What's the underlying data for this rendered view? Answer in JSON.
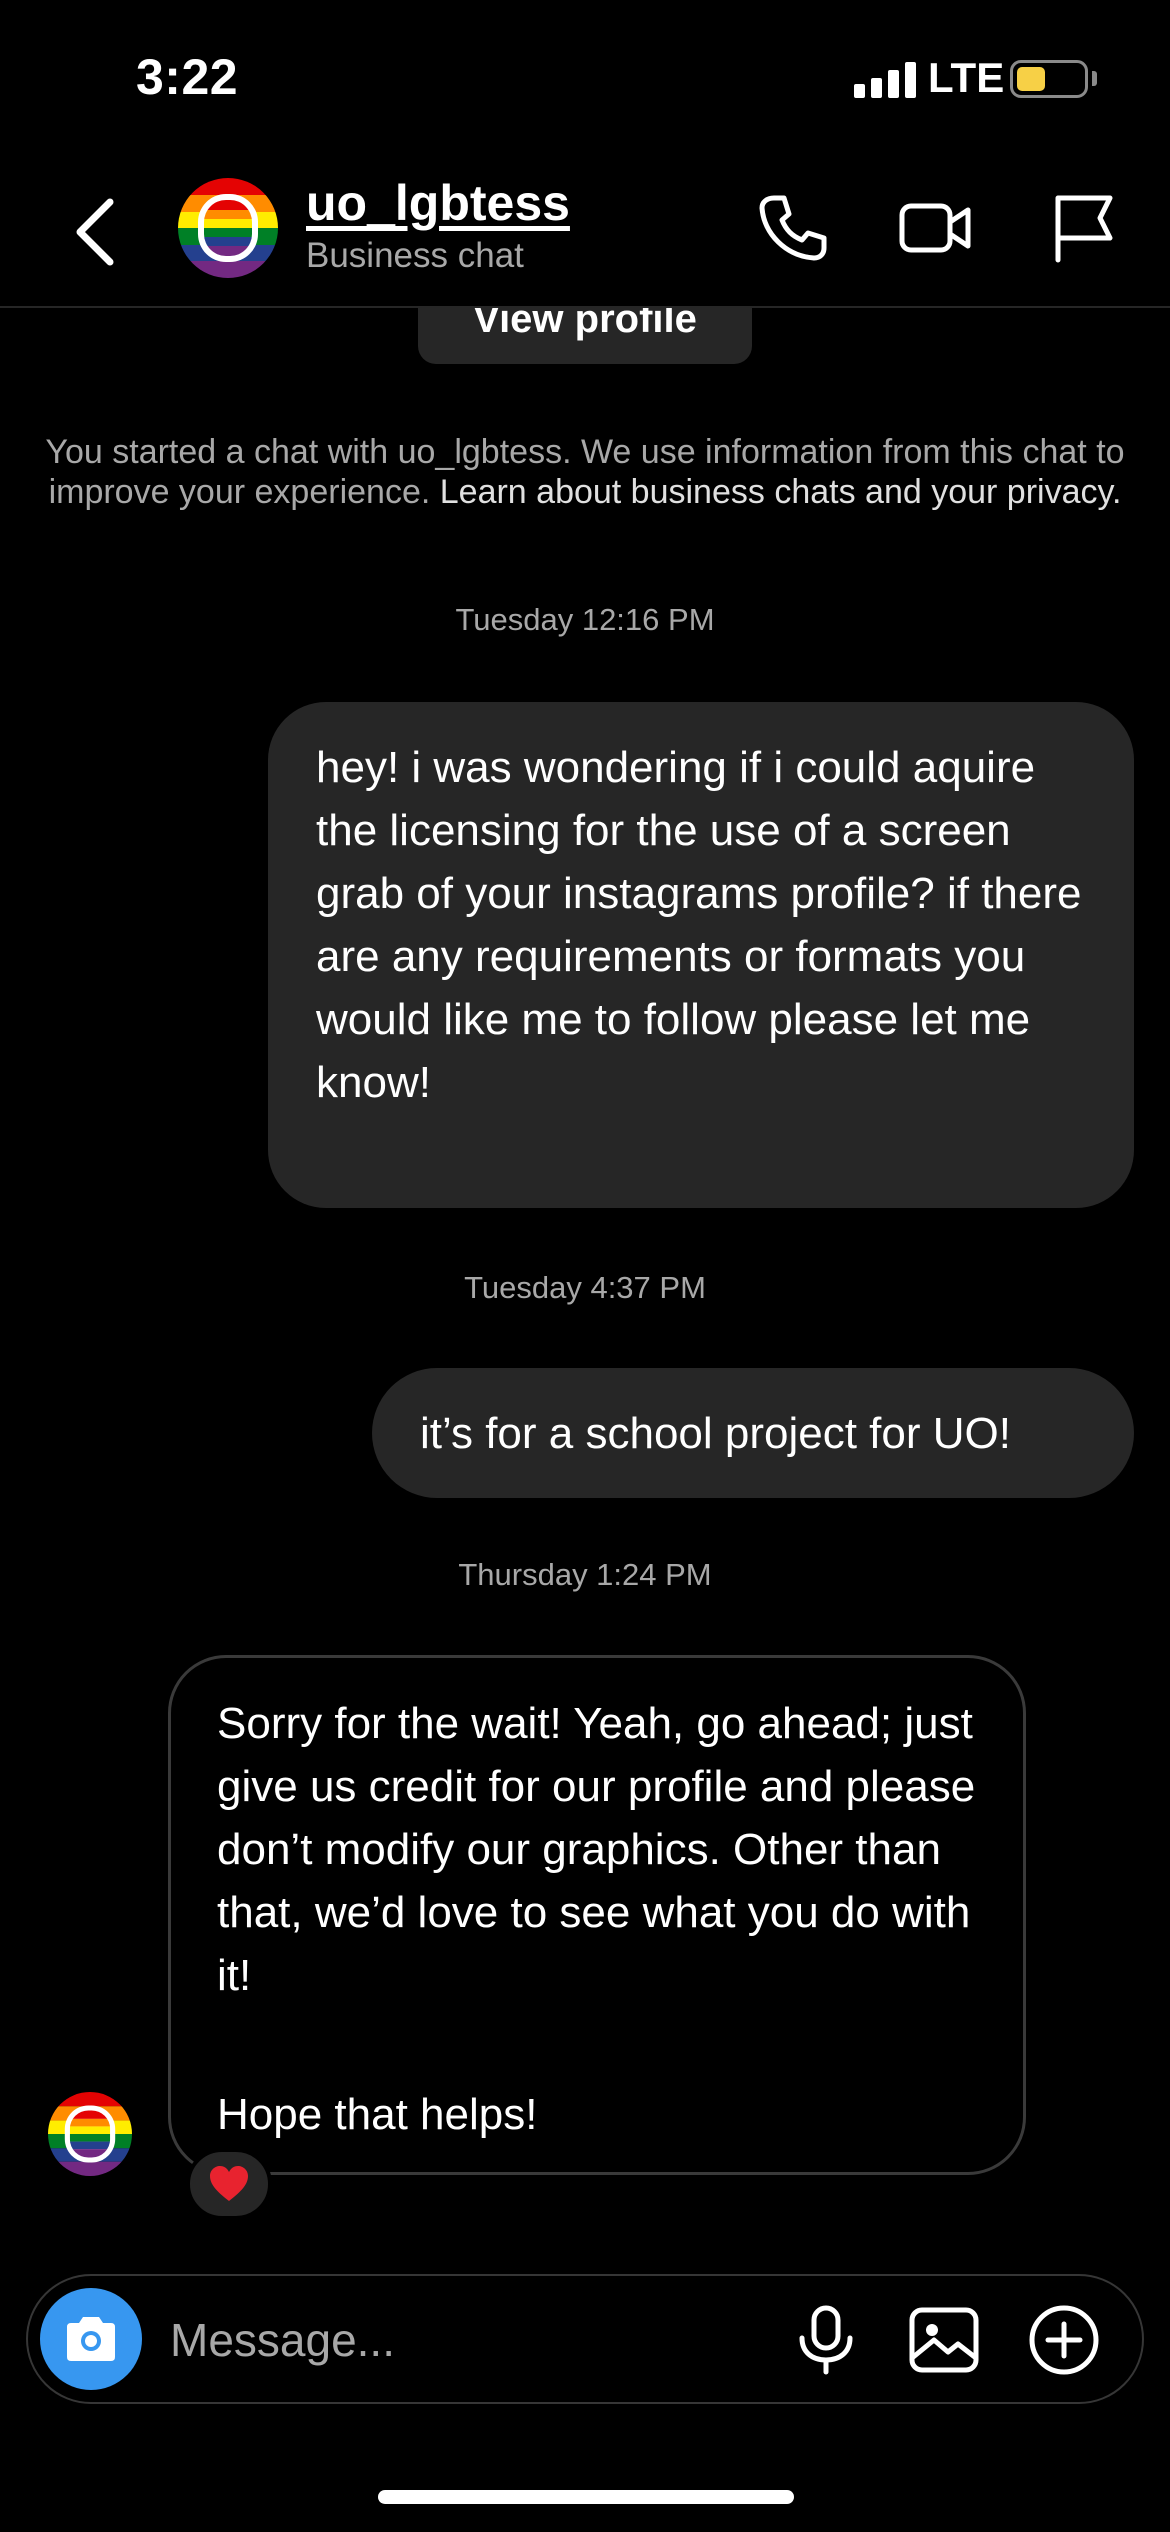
{
  "status_bar": {
    "time": "3:22",
    "network": "LTE"
  },
  "header": {
    "username": "uo_lgbtess",
    "subtitle": "Business chat"
  },
  "view_profile_label": "View profile",
  "notice": {
    "text": "You started a chat with uo_lgbtess. We use information from this chat to improve your experience. ",
    "link": "Learn about business chats and your privacy."
  },
  "messages": [
    {
      "timestamp": "Tuesday 12:16 PM",
      "direction": "outgoing",
      "text": "hey! i was wondering if i could aquire the licensing for the use of a screen grab of your instagrams profile? if there are any requirements or formats you would like me to follow please let me know!"
    },
    {
      "timestamp": "Tuesday 4:37 PM",
      "direction": "outgoing",
      "text": "it’s for a school project for UO!"
    },
    {
      "timestamp": "Thursday 1:24 PM",
      "direction": "incoming",
      "text": "Sorry for the wait! Yeah, go ahead; just give us credit for our profile and please don’t modify our graphics. Other than that, we’d love to see what you do with it!",
      "text2": "Hope that helps!",
      "reaction": "❤️"
    }
  ],
  "composer": {
    "placeholder": "Message..."
  },
  "colors": {
    "accent": "#3797f0",
    "bubble": "#262626",
    "muted": "#a8a8a8",
    "battery": "#f7d046"
  }
}
